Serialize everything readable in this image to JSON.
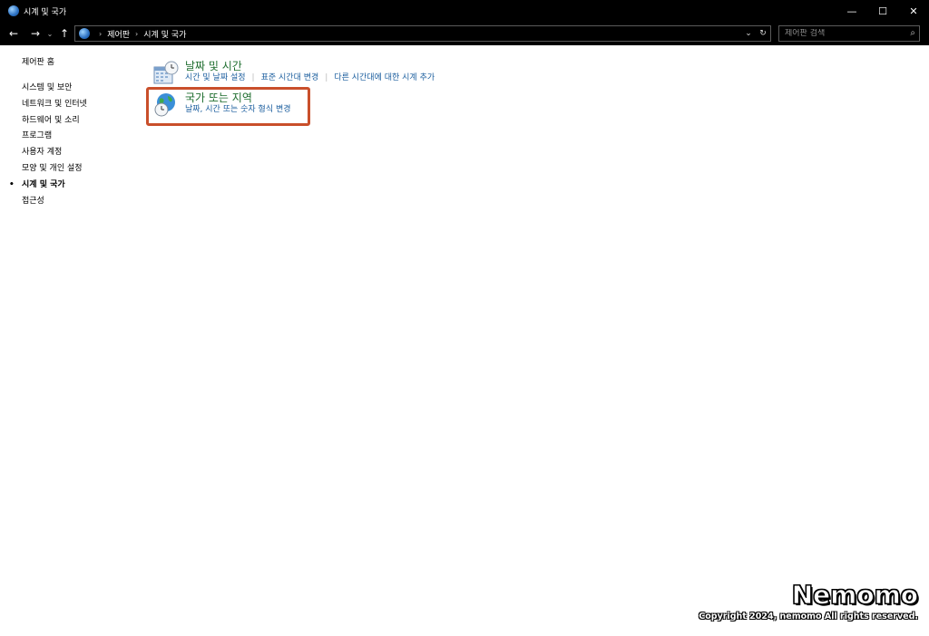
{
  "window": {
    "title": "시계 및 국가",
    "controls": {
      "minimize": "—",
      "maximize": "☐",
      "close": "✕"
    }
  },
  "nav": {
    "back_glyph": "←",
    "forward_glyph": "→",
    "recent_glyph": "⌄",
    "up_glyph": "↑",
    "breadcrumb": [
      "제어판",
      "시계 및 국가"
    ],
    "breadcrumb_separator": "›",
    "dropdown_glyph": "⌄",
    "refresh_glyph": "↻"
  },
  "search": {
    "placeholder": "제어판 검색",
    "icon": "search-icon",
    "icon_glyph": "⌕"
  },
  "sidebar": {
    "home_label": "제어판 홈",
    "items": [
      {
        "label": "시스템 및 보안",
        "active": false
      },
      {
        "label": "네트워크 및 인터넷",
        "active": false
      },
      {
        "label": "하드웨어 및 소리",
        "active": false
      },
      {
        "label": "프로그램",
        "active": false
      },
      {
        "label": "사용자 계정",
        "active": false
      },
      {
        "label": "모양 및 개인 설정",
        "active": false
      },
      {
        "label": "시계 및 국가",
        "active": true,
        "bullet": "•"
      },
      {
        "label": "접근성",
        "active": false
      }
    ]
  },
  "categories": {
    "datetime": {
      "icon": "calendar-clock-icon",
      "title": "날짜 및 시간",
      "links": [
        "시간 및 날짜 설정",
        "표준 시간대 변경",
        "다른 시간대에 대한 시계 추가"
      ],
      "divider": "|"
    },
    "region": {
      "icon": "globe-clock-icon",
      "title": "국가 또는 지역",
      "links": [
        "날짜, 시간 또는 숫자 형식 변경"
      ]
    }
  },
  "watermark": {
    "brand": "Nemomo",
    "copyright": "Copyright 2024, nemomo All rights reserved."
  },
  "colors": {
    "title_bar": "#000000",
    "category_title": "#1e6d2e",
    "link": "#1a5d9e",
    "highlight": "#c94f2b"
  }
}
